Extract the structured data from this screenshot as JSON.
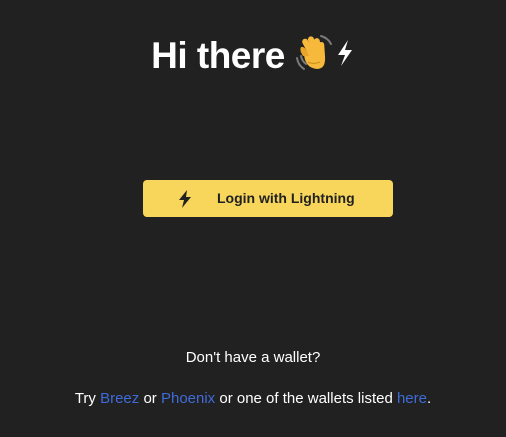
{
  "heading": {
    "text": "Hi there",
    "icons": [
      "waving-hand-icon",
      "lightning-bolt-icon"
    ]
  },
  "login_button": {
    "label": "Login with Lightning",
    "icon": "lightning-bolt-icon"
  },
  "footer": {
    "no_wallet_text": "Don't have a wallet?",
    "try_prefix": "Try",
    "link_breez": "Breez",
    "or_text": "or",
    "link_phoenix": "Phoenix",
    "middle_text": "or one of the wallets listed",
    "link_here": "here",
    "suffix": "."
  },
  "colors": {
    "background": "#212121",
    "button": "#f8d55b",
    "link": "#3f6bd9",
    "text": "#ffffff"
  }
}
